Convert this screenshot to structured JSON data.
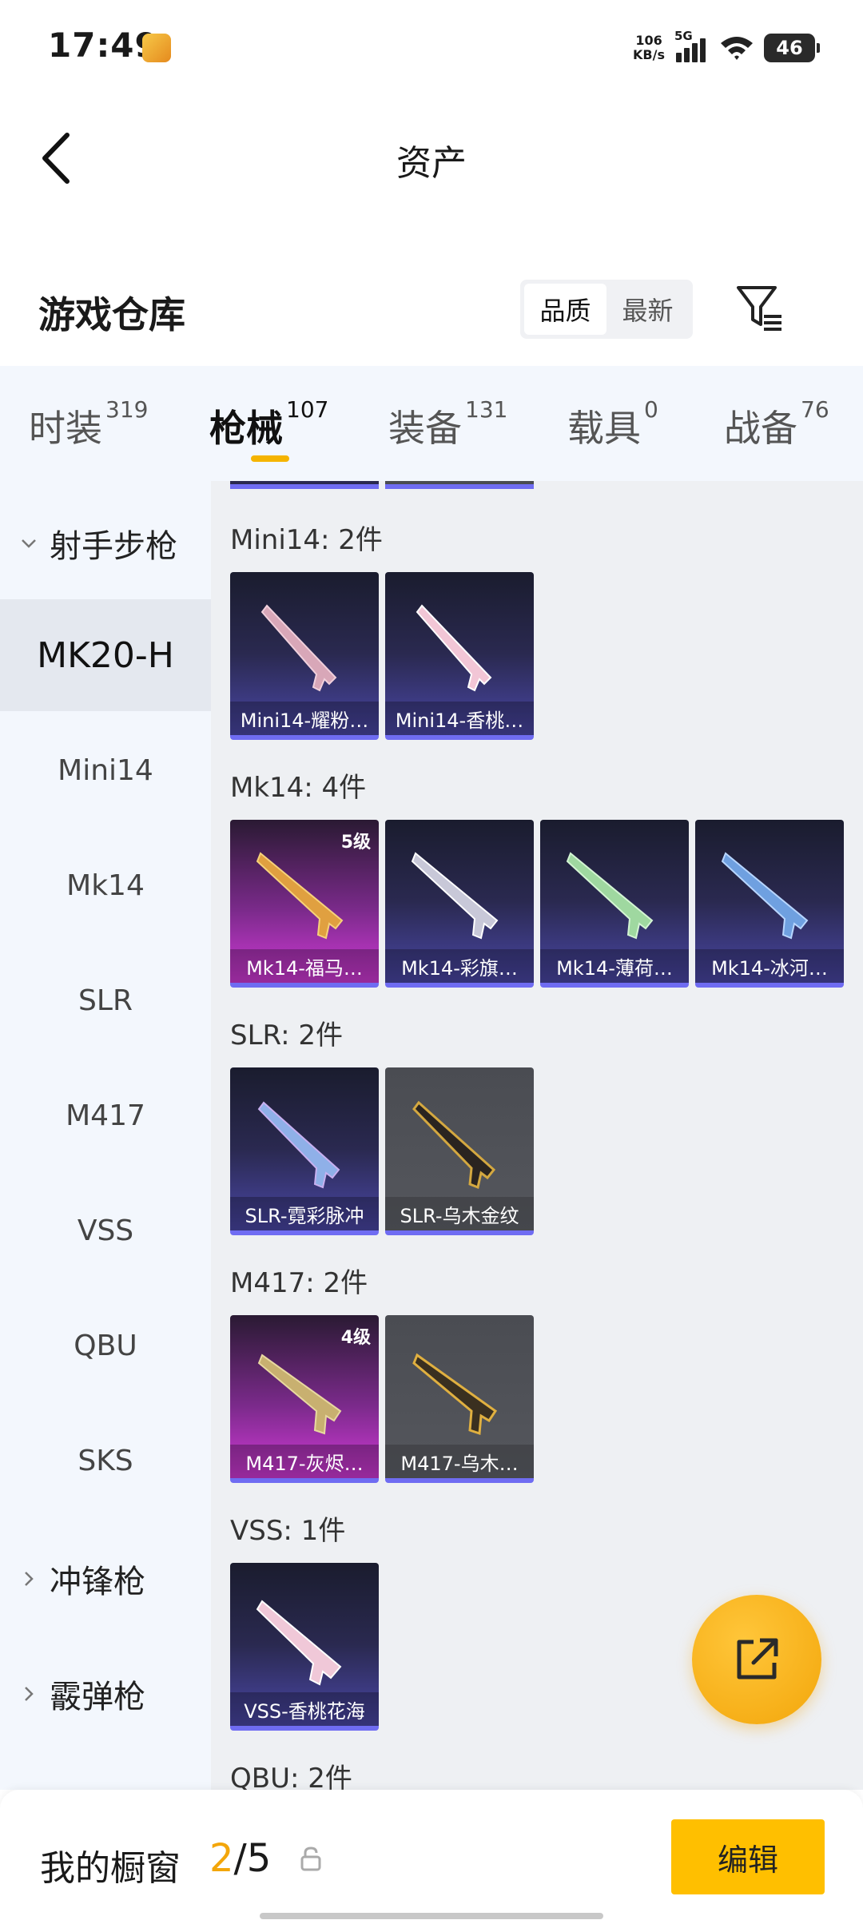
{
  "status_bar": {
    "time": "17:49",
    "net_speed_value": "106",
    "net_speed_unit": "KB/s",
    "network": "5G",
    "battery": "46"
  },
  "header": {
    "title": "资产"
  },
  "section": {
    "title": "游戏仓库",
    "sort_options": [
      "品质",
      "最新"
    ],
    "sort_active": "品质"
  },
  "tabs": [
    {
      "label": "时装",
      "count": "319"
    },
    {
      "label": "枪械",
      "count": "107"
    },
    {
      "label": "装备",
      "count": "131"
    },
    {
      "label": "载具",
      "count": "0"
    },
    {
      "label": "战备",
      "count": "76"
    }
  ],
  "active_tab": "枪械",
  "sidebar": {
    "group_expanded": "射手步枪",
    "items": [
      "MK20-H",
      "Mini14",
      "Mk14",
      "SLR",
      "M417",
      "VSS",
      "QBU",
      "SKS"
    ],
    "active_item": "MK20-H",
    "collapsed_groups": [
      "冲锋枪",
      "霰弹枪"
    ]
  },
  "groups": [
    {
      "title": "Mini14: 2件",
      "cards": [
        {
          "name": "Mini14-耀粉…",
          "style": "purple"
        },
        {
          "name": "Mini14-香桃…",
          "style": "purple"
        }
      ]
    },
    {
      "title": "Mk14: 4件",
      "cards": [
        {
          "name": "Mk14-福马…",
          "style": "pink",
          "level": "5级"
        },
        {
          "name": "Mk14-彩旗…",
          "style": "purple"
        },
        {
          "name": "Mk14-薄荷…",
          "style": "purple"
        },
        {
          "name": "Mk14-冰河…",
          "style": "purple"
        }
      ]
    },
    {
      "title": "SLR: 2件",
      "cards": [
        {
          "name": "SLR-霓彩脉冲",
          "style": "purple"
        },
        {
          "name": "SLR-乌木金纹",
          "style": "gray"
        }
      ]
    },
    {
      "title": "M417: 2件",
      "cards": [
        {
          "name": "M417-灰烬…",
          "style": "pink",
          "level": "4级"
        },
        {
          "name": "M417-乌木…",
          "style": "gray"
        }
      ]
    },
    {
      "title": "VSS: 1件",
      "cards": [
        {
          "name": "VSS-香桃花海",
          "style": "purple"
        }
      ]
    },
    {
      "title": "QBU: 2件",
      "cards": []
    }
  ],
  "bottom_bar": {
    "label": "我的橱窗",
    "current": "2",
    "separator": "/",
    "total": "5",
    "edit_label": "编辑"
  },
  "colors": {
    "accent": "#ffbf00",
    "tab_underline": "#f5b400",
    "card_border": "#6f6cf2"
  }
}
